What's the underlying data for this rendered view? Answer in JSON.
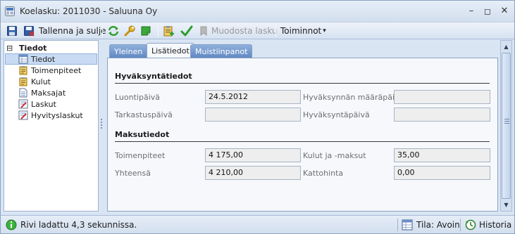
{
  "window": {
    "title": "Koelasku: 2011030 - Saluuna Oy",
    "minimize_glyph": "–",
    "maximize_glyph": "◻",
    "close_glyph": "✕"
  },
  "toolbar": {
    "save_close_label": "Tallenna ja sulje",
    "create_invoice_label": "Muodosta lasku",
    "actions_label": "Toiminnot",
    "actions_arrow": "▾"
  },
  "tree": {
    "expander": "⊟",
    "root_label": "Tiedot",
    "items": [
      {
        "label": "Tiedot",
        "selected": true
      },
      {
        "label": "Toimenpiteet"
      },
      {
        "label": "Kulut"
      },
      {
        "label": "Maksajat"
      },
      {
        "label": "Laskut"
      },
      {
        "label": "Hyvityslaskut"
      }
    ]
  },
  "tabs": [
    {
      "label": "Yleinen"
    },
    {
      "label": "Lisätiedot",
      "active": true
    },
    {
      "label": "Muistiinpanot"
    }
  ],
  "approval": {
    "section_title": "Hyväksyntätiedot",
    "created_label": "Luontipäivä",
    "created_value": "24.5.2012",
    "checked_label": "Tarkastuspäivä",
    "checked_value": "",
    "approval_deadline_label": "Hyväksynnän määräpäivä",
    "approval_deadline_value": "",
    "approval_date_label": "Hyväksyntäpäivä",
    "approval_date_value": ""
  },
  "payment": {
    "section_title": "Maksutiedot",
    "measures_label": "Toimenpiteet",
    "measures_value": "4 175,00",
    "costs_label": "Kulut ja -maksut",
    "costs_value": "35,00",
    "total_label": "Yhteensä",
    "total_value": "4 210,00",
    "roof_price_label": "Kattohinta",
    "roof_price_value": "0,00"
  },
  "status": {
    "message": "Rivi ladattu 4,3 sekunnissa.",
    "state": "Tila: Avoin",
    "history_label": "Historia"
  },
  "scrollbar": {
    "up": "▲",
    "down": "▼"
  },
  "colors": {
    "accent": "#2f5ea6",
    "tab_inactive": "#6a90c9",
    "success": "#2a9d2a",
    "status_green": "#3db33d"
  }
}
